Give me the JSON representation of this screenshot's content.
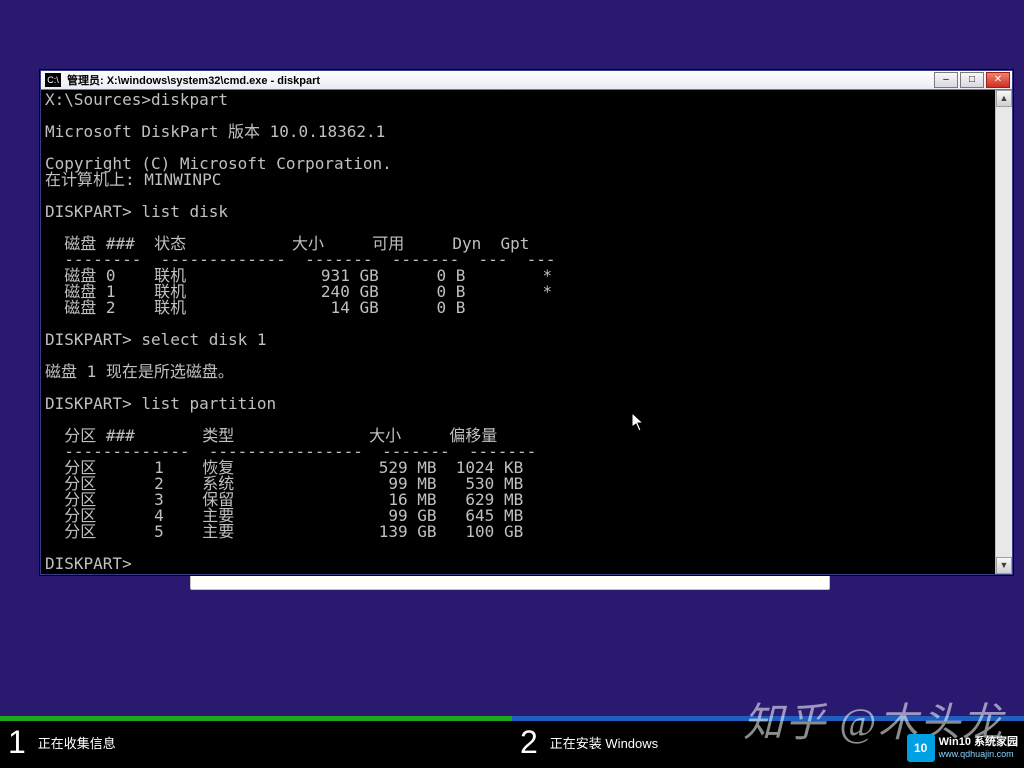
{
  "window": {
    "title": "管理员: X:\\windows\\system32\\cmd.exe - diskpart",
    "icon_label": "C:\\",
    "buttons": {
      "min": "–",
      "max": "□",
      "close": "✕"
    }
  },
  "terminal": {
    "prompt_initial": "X:\\Sources>diskpart",
    "version_line": "Microsoft DiskPart 版本 10.0.18362.1",
    "copyright": "Copyright (C) Microsoft Corporation.",
    "computer_line": "在计算机上: MINWINPC",
    "prompt": "DISKPART>",
    "cmd_list_disk": "list disk",
    "disk_header": "  磁盘 ###  状态           大小     可用     Dyn  Gpt",
    "disk_divider": "  --------  -------------  -------  -------  ---  ---",
    "disks": [
      "  磁盘 0    联机              931 GB      0 B        *",
      "  磁盘 1    联机              240 GB      0 B        *",
      "  磁盘 2    联机               14 GB      0 B"
    ],
    "cmd_select": "select disk 1",
    "select_result": "磁盘 1 现在是所选磁盘。",
    "cmd_list_part": "list partition",
    "part_header": "  分区 ###       类型              大小     偏移量",
    "part_divider": "  -------------  ----------------  -------  -------",
    "parts": [
      "  分区      1    恢复               529 MB  1024 KB",
      "  分区      2    系统                99 MB   530 MB",
      "  分区      3    保留                16 MB   629 MB",
      "  分区      4    主要                99 GB   645 MB",
      "  分区      5    主要               139 GB   100 GB"
    ],
    "final_prompt": "DISKPART>"
  },
  "steps": {
    "s1": {
      "num": "1",
      "label": "正在收集信息"
    },
    "s2": {
      "num": "2",
      "label": "正在安装 Windows"
    }
  },
  "watermark": {
    "zhihu": "知乎 @木头龙",
    "logo_badge": "10",
    "logo_l1": "Win10 系统家园",
    "logo_l2": "www.qdhuajin.com"
  },
  "chart_data": {
    "type": "table",
    "disks": [
      {
        "index": 0,
        "status": "联机",
        "size": "931 GB",
        "free": "0 B",
        "dyn": "",
        "gpt": "*"
      },
      {
        "index": 1,
        "status": "联机",
        "size": "240 GB",
        "free": "0 B",
        "dyn": "",
        "gpt": "*"
      },
      {
        "index": 2,
        "status": "联机",
        "size": "14 GB",
        "free": "0 B",
        "dyn": "",
        "gpt": ""
      }
    ],
    "partitions_disk1": [
      {
        "index": 1,
        "type": "恢复",
        "size": "529 MB",
        "offset": "1024 KB"
      },
      {
        "index": 2,
        "type": "系统",
        "size": "99 MB",
        "offset": "530 MB"
      },
      {
        "index": 3,
        "type": "保留",
        "size": "16 MB",
        "offset": "629 MB"
      },
      {
        "index": 4,
        "type": "主要",
        "size": "99 GB",
        "offset": "645 MB"
      },
      {
        "index": 5,
        "type": "主要",
        "size": "139 GB",
        "offset": "100 GB"
      }
    ]
  }
}
